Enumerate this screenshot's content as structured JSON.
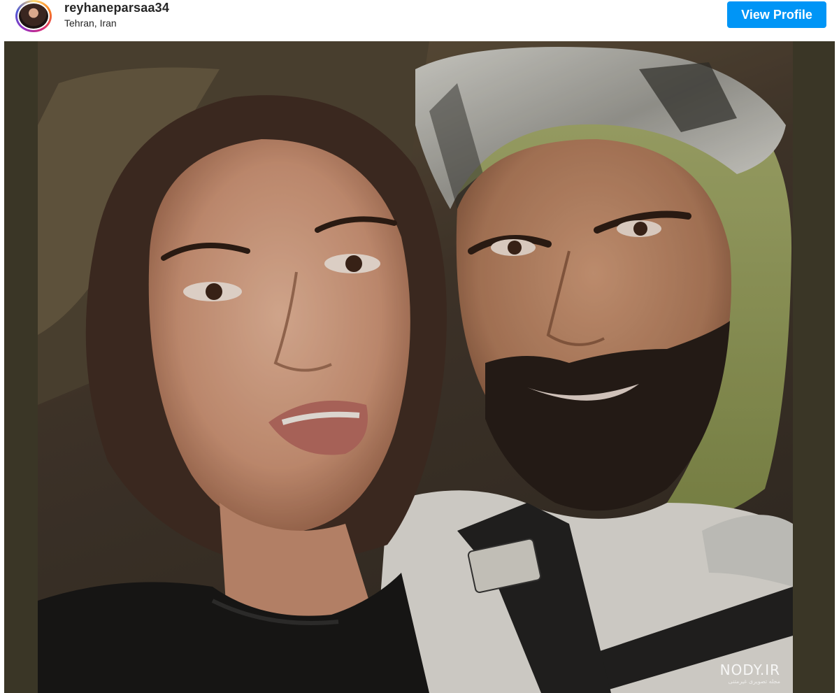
{
  "header": {
    "username": "reyhaneparsaa34",
    "location": "Tehran, Iran",
    "view_profile_label": "View Profile",
    "avatar_icon": "profile-avatar"
  },
  "photo": {
    "watermark": "NODY.IR",
    "watermark_sub": "مجله تصویری غیرمتنی"
  },
  "colors": {
    "button": "#0095f6",
    "frame": "#3a3626",
    "text": "#262626"
  }
}
